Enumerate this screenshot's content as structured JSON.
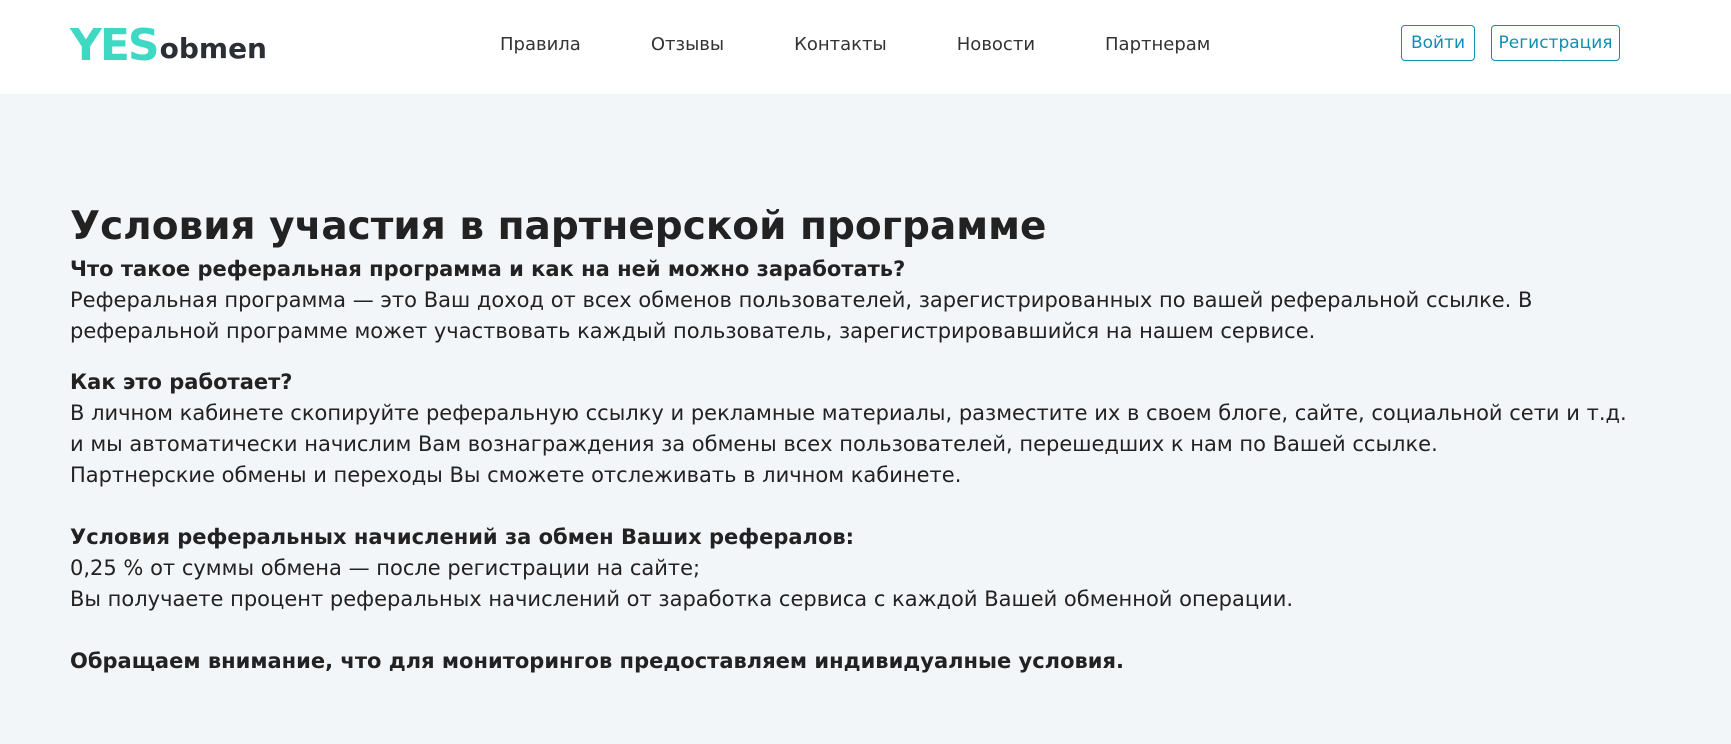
{
  "header": {
    "logo": {
      "part1": "YES",
      "part2": "obmen"
    },
    "nav": [
      "Правила",
      "Отзывы",
      "Контакты",
      "Новости",
      "Партнерам"
    ],
    "login": "Войти",
    "register": "Регистрация"
  },
  "content": {
    "title": "Условия участия в партнерской программе",
    "q1": "Что такое реферальная программа и как на ней можно заработать?",
    "p1": "Реферальная программа — это Ваш доход от всех обменов пользователей, зарегистрированных по вашей реферальной ссылке. В реферальной программе может участвовать каждый пользователь, зарегистрировавшийся на нашем сервисе.",
    "q2": "Как это работает?",
    "p2": "В личном кабинете скопируйте реферальную ссылку и рекламные материалы, разместите их в своем блоге, сайте, социальной сети и т.д. и мы автоматически начислим Вам вознаграждения за обмены всех пользователей, перешедших к нам по Вашей ссылке.",
    "p3": "Партнерские обмены и переходы Вы сможете отслеживать в личном кабинете.",
    "q3": "Условия реферальных начислений за обмен Ваших рефералов:",
    "p4": "0,25 % от суммы обмена — после регистрации на сайте;",
    "p5": "Вы получаете процент реферальных начислений от заработка сервиса с каждой Вашей обменной операции.",
    "note": "Обращаем внимание, что для мониторингов предоставляем индивидуалные условия."
  }
}
